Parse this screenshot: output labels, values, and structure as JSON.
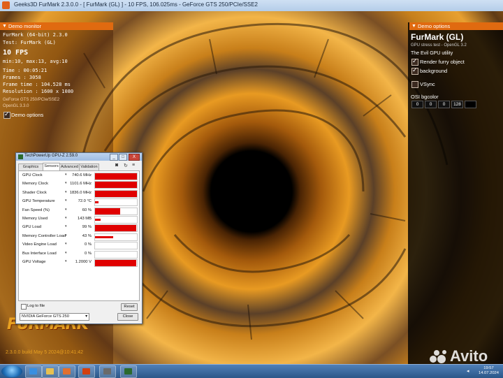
{
  "window": {
    "title": "Geeks3D FurMark 2.3.0.0 - [ FurMark (GL) ] - 10 FPS, 106.025ms - GeForce GTS 250/PCIe/SSE2"
  },
  "monitor": {
    "header": "Demo monitor",
    "line1": "FurMark (64-bit) 2.3.0",
    "line2": "Test: FurMark (GL)",
    "fps": "10 FPS",
    "minmax": "min:10, max:13, avg:10",
    "time": "Time       : 00:05:21",
    "frames": "Frames     : 3058",
    "frame_time": "Frame time : 104.528 ms",
    "resolution": "Resolution : 1600 x 1080",
    "gpu_line1": "GeForce GTS 250/PCIe/SSE2",
    "gpu_line2": "OpenGL 3.3.0",
    "demo_options": "Demo options"
  },
  "logo": {
    "text": "FURMARK",
    "build": "2.3.0.0 build May  5 2024@10:41:42"
  },
  "options": {
    "header": "Demo options",
    "title": "FurMark (GL)",
    "subtitle": "GPU stress test - OpenGL 3.2",
    "section": "The Evil GPU utility",
    "render_furry": "Render furry object",
    "background": "background",
    "vsync": "VSync",
    "osi_label": "OSI bgcolor",
    "osi_values": [
      "0",
      "0",
      "0",
      "128"
    ]
  },
  "gpuz": {
    "title": "TechPowerUp GPU-Z 2.59.0",
    "min_btn": "_",
    "max_btn": "□",
    "close_btn": "X",
    "tabs": [
      "Graphics Card",
      "Sensors",
      "Advanced",
      "Validation"
    ],
    "sensors": [
      {
        "name": "GPU Clock",
        "value": "740.6 MHz",
        "level": 1.0
      },
      {
        "name": "Memory Clock",
        "value": "1101.6 MHz",
        "level": 1.0
      },
      {
        "name": "Shader Clock",
        "value": "1836.0 MHz",
        "level": 1.0
      },
      {
        "name": "GPU Temperature",
        "value": "72.0 °C",
        "level": 0.08
      },
      {
        "name": "Fan Speed (%)",
        "value": "60 %",
        "level": 0.6
      },
      {
        "name": "Memory Used",
        "value": "143 MB",
        "level": 0.14
      },
      {
        "name": "GPU Load",
        "value": "99 %",
        "level": 0.99
      },
      {
        "name": "Memory Controller Load",
        "value": "43 %",
        "level": 0.43
      },
      {
        "name": "Video Engine Load",
        "value": "0 %",
        "level": 0.0
      },
      {
        "name": "Bus Interface Load",
        "value": "0 %",
        "level": 0.0
      },
      {
        "name": "GPU Voltage",
        "value": "1.2000 V",
        "level": 0.98
      }
    ],
    "log_label": "Log to file",
    "reset": "Reset",
    "gpu_select": "NVIDIA GeForce GTS 250",
    "close": "Close"
  },
  "taskbar": {
    "time": "19:57",
    "date": "14.07.2024"
  },
  "watermark": "Avito",
  "colors": {
    "accent": "#e06a10",
    "sensor_bar": "#e00000",
    "taskbar": "#2b5788"
  }
}
